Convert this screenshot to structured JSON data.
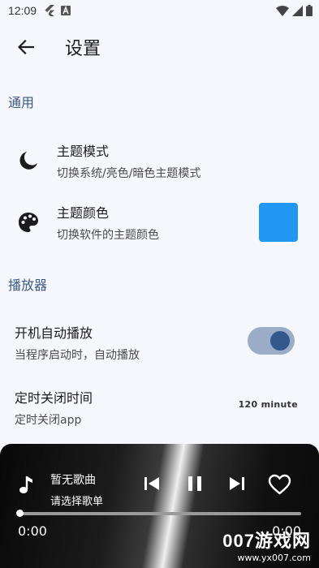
{
  "status_bar": {
    "time": "12:09"
  },
  "app_bar": {
    "title": "设置"
  },
  "sections": {
    "general": "通用",
    "player": "播放器"
  },
  "settings": {
    "theme_mode": {
      "title": "主题模式",
      "subtitle": "切换系统/亮色/暗色主题模式"
    },
    "theme_color": {
      "title": "主题颜色",
      "subtitle": "切换软件的主题颜色",
      "color": "#2196f3"
    },
    "autoplay": {
      "title": "开机自动播放",
      "subtitle": "当程序启动时，自动播放",
      "enabled": true
    },
    "sleep_timer": {
      "title": "定时关闭时间",
      "subtitle": "定时关闭app",
      "value": "120 minute"
    }
  },
  "player": {
    "song_title": "暂无歌曲",
    "song_subtitle": "请选择歌单",
    "current_time": "0:00",
    "total_time": "0:00",
    "progress": 0
  },
  "watermark": {
    "main": "007游戏网",
    "url": "www.yx007.com"
  },
  "colors": {
    "background": "#f6f7fc",
    "section_header": "#3c5a88",
    "switch_track": "#9aacc8",
    "switch_thumb": "#34578c",
    "theme_color_swatch": "#2196f3"
  },
  "icons": {
    "status": [
      "flutter-icon",
      "a-icon",
      "wifi-icon",
      "signal-icon",
      "battery-icon"
    ],
    "back": "arrow-left-icon",
    "theme_mode": "moon-icon",
    "theme_color": "palette-icon",
    "music": "music-note-icon",
    "prev": "skip-previous-icon",
    "pause": "pause-icon",
    "next": "skip-next-icon",
    "favorite": "heart-outline-icon"
  }
}
